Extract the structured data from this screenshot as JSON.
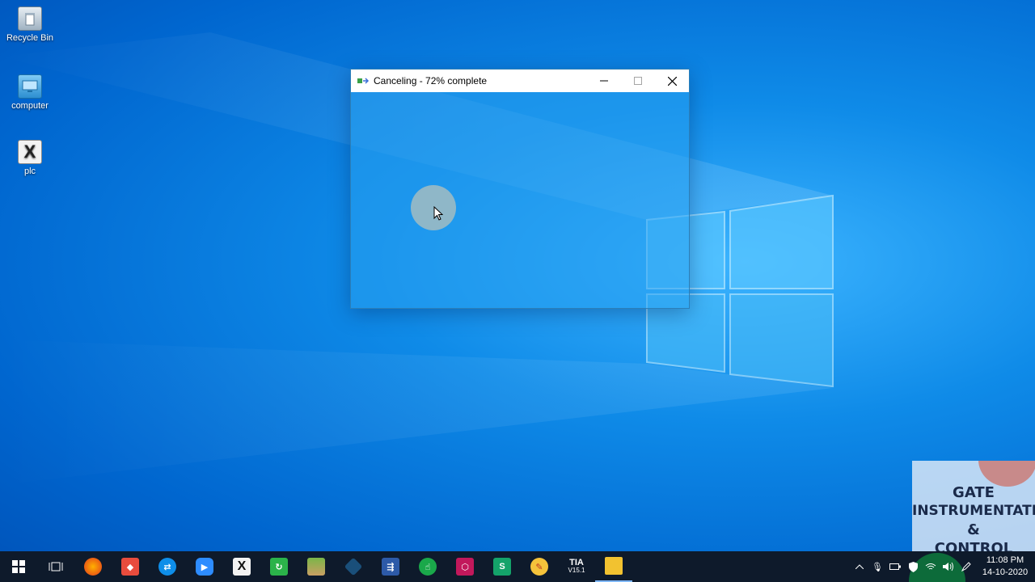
{
  "desktop": {
    "icons": [
      {
        "label": "Recycle Bin",
        "icon": "recycle-bin-icon"
      },
      {
        "label": "computer",
        "icon": "computer-icon"
      },
      {
        "label": "plc",
        "icon": "xml-file-icon"
      }
    ]
  },
  "dialog": {
    "title": "Canceling - 72% complete",
    "progress_percent": 72,
    "buttons": {
      "minimize": "minimize-icon",
      "maximize": "maximize-icon",
      "close": "close-icon"
    }
  },
  "watermark": {
    "lines": [
      "GATE",
      "INSTRUMENTATION",
      "&",
      "CONTROL"
    ]
  },
  "taskbar": {
    "apps": [
      "start-icon",
      "task-view-icon",
      "firefox-icon",
      "anydesk-icon",
      "teamviewer-icon",
      "zoom-icon",
      "xml-editor-icon",
      "remote-tool-icon",
      "image-app-icon",
      "kite-icon",
      "git-icon",
      "touch-app-icon",
      "cube-app-icon",
      "sync-app-icon",
      "paint-icon",
      "tia-portal-icon",
      "file-explorer-icon"
    ],
    "tia_label": "TIA",
    "tia_version": "V15.1"
  },
  "tray": {
    "time": "11:08 PM",
    "date": "14-10-2020"
  },
  "colors": {
    "desktop_blue": "#0f8be8",
    "taskbar": "#0e1a2b",
    "titlebar": "#ffffff"
  }
}
